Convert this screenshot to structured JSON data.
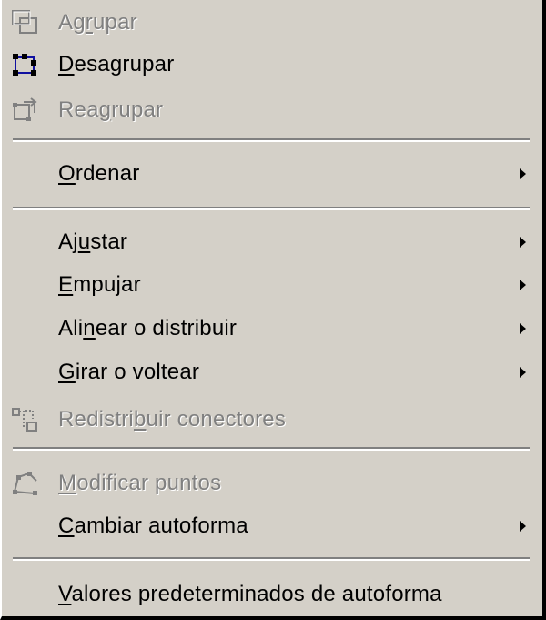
{
  "menu": {
    "items": [
      {
        "label_pre": "Ag",
        "label_acc": "r",
        "label_post": "upar",
        "enabled": false,
        "icon": "group-icon"
      },
      {
        "label_pre": "",
        "label_acc": "D",
        "label_post": "esagrupar",
        "enabled": true,
        "icon": "ungroup-icon"
      },
      {
        "label_pre": "Rea",
        "label_acc": "g",
        "label_post": "rupar",
        "enabled": false,
        "icon": "regroup-icon"
      },
      {
        "label_pre": "",
        "label_acc": "O",
        "label_post": "rdenar",
        "enabled": true,
        "submenu": true
      },
      {
        "label_pre": "Aj",
        "label_acc": "u",
        "label_post": "star",
        "enabled": true,
        "submenu": true
      },
      {
        "label_pre": "",
        "label_acc": "E",
        "label_post": "mpujar",
        "enabled": true,
        "submenu": true
      },
      {
        "label_pre": "Ali",
        "label_acc": "n",
        "label_post": "ear o distribuir",
        "enabled": true,
        "submenu": true
      },
      {
        "label_pre": "",
        "label_acc": "G",
        "label_post": "irar o voltear",
        "enabled": true,
        "submenu": true
      },
      {
        "label_pre": "Redistri",
        "label_acc": "b",
        "label_post": "uir conectores",
        "enabled": false,
        "icon": "reroute-connectors-icon"
      },
      {
        "label_pre": "",
        "label_acc": "M",
        "label_post": "odificar puntos",
        "enabled": false,
        "icon": "edit-points-icon"
      },
      {
        "label_pre": "",
        "label_acc": "C",
        "label_post": "ambiar autoforma",
        "enabled": true,
        "submenu": true
      },
      {
        "label_pre": "",
        "label_acc": "V",
        "label_post": "alores predeterminados de autoforma",
        "enabled": true
      }
    ]
  }
}
